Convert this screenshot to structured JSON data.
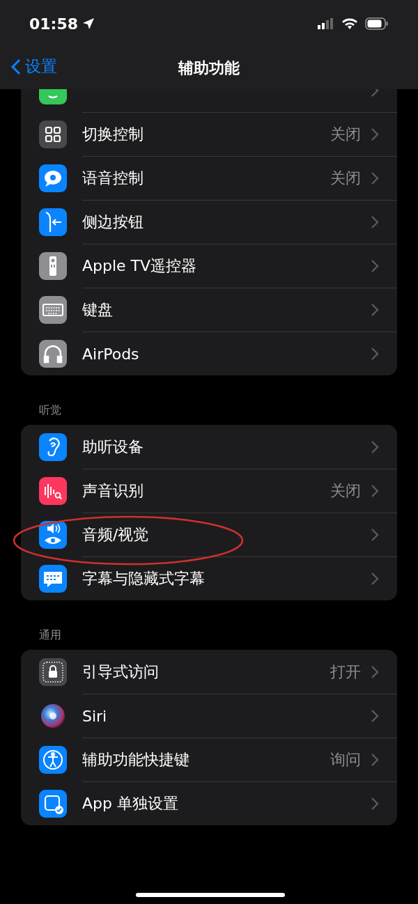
{
  "status_bar": {
    "time": "01:58"
  },
  "nav": {
    "back": "设置",
    "title": "辅助功能"
  },
  "sections": [
    {
      "items": [
        {
          "color": "#34c759"
        },
        {
          "label": "切换控制",
          "value": "关闭",
          "color": "#48484a"
        },
        {
          "label": "语音控制",
          "value": "关闭",
          "color": "#0a84ff"
        },
        {
          "label": "侧边按钮",
          "color": "#0a84ff"
        },
        {
          "label": "Apple TV遥控器",
          "color": "#8e8e93"
        },
        {
          "label": "键盘",
          "color": "#8e8e93"
        },
        {
          "label": "AirPods",
          "color": "#8e8e93"
        }
      ]
    },
    {
      "header": "听觉",
      "items": [
        {
          "label": "助听设备",
          "color": "#0a84ff"
        },
        {
          "label": "声音识别",
          "value": "关闭",
          "color": "#ff375f"
        },
        {
          "label": "音频/视觉",
          "color": "#0a84ff",
          "circled": true
        },
        {
          "label": "字幕与隐藏式字幕",
          "color": "#0a84ff"
        }
      ]
    },
    {
      "header": "通用",
      "items": [
        {
          "label": "引导式访问",
          "value": "打开",
          "color": "#48484a"
        },
        {
          "label": "Siri"
        },
        {
          "label": "辅助功能快捷键",
          "value": "询问",
          "color": "#0a84ff"
        },
        {
          "label": "App 单独设置",
          "color": "#0a84ff"
        }
      ]
    }
  ]
}
